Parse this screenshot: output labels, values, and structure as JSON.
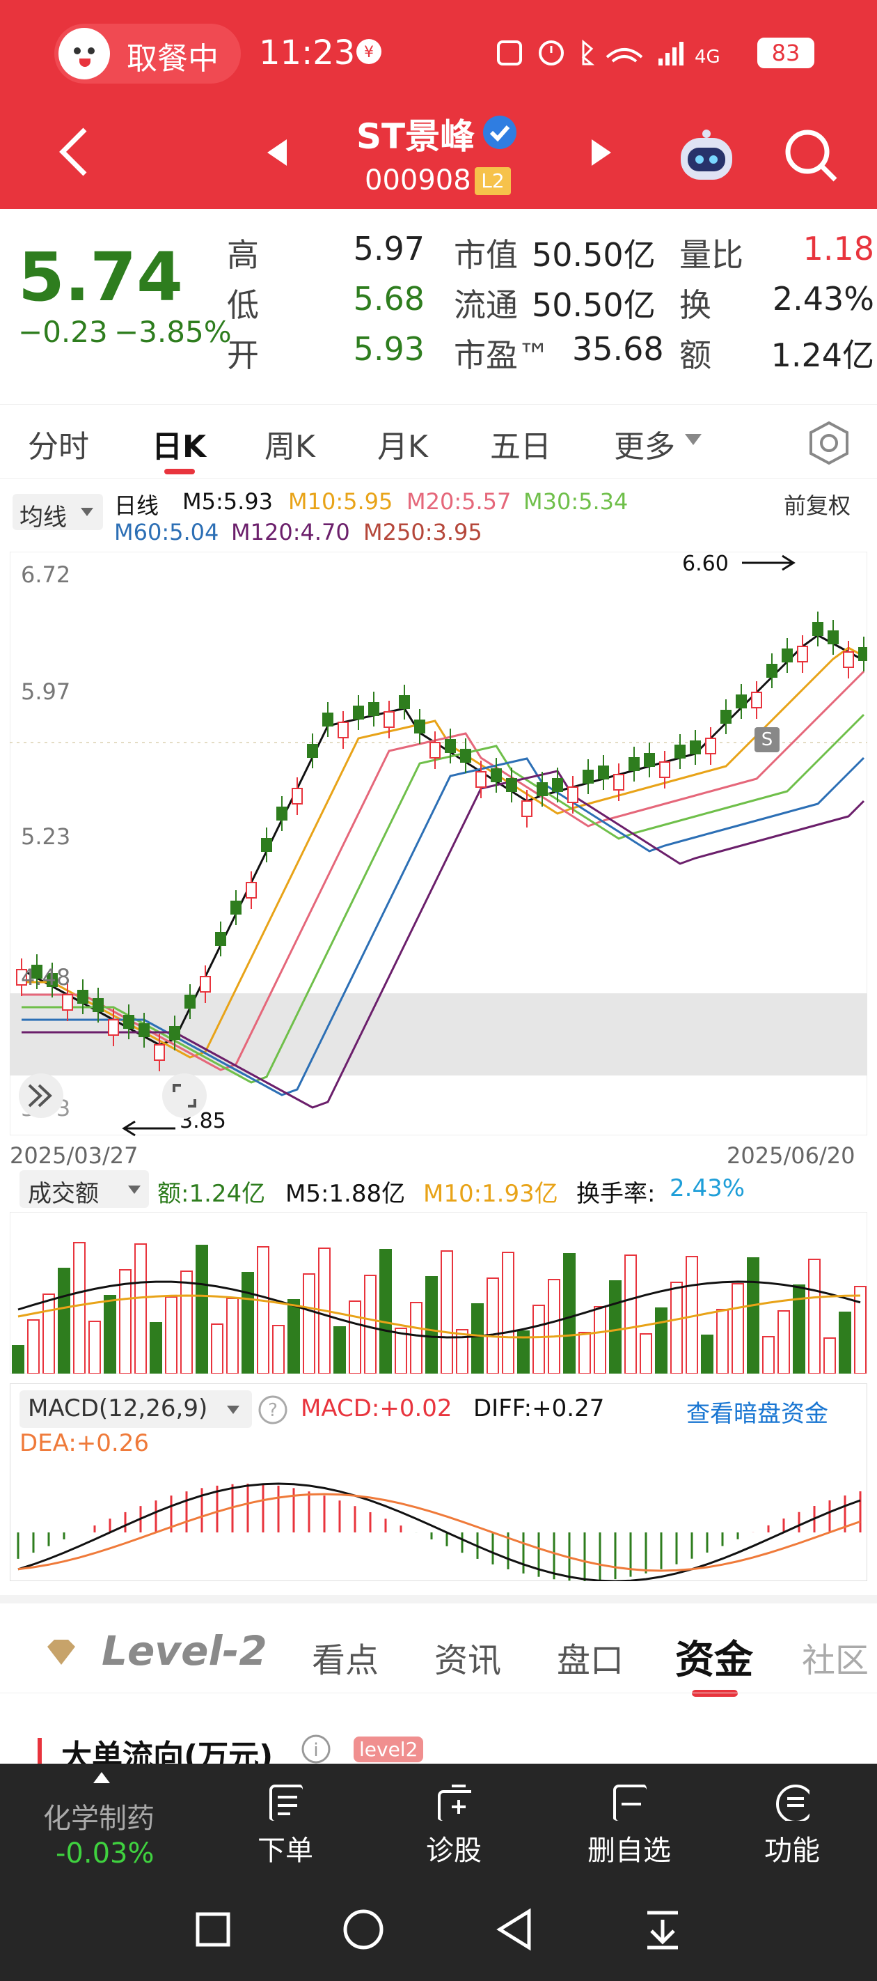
{
  "statusbar": {
    "app_pill": "取餐中",
    "time": "11:23",
    "battery": "83"
  },
  "header": {
    "stock_name": "ST景峰",
    "stock_code": "000908",
    "badge": "L2"
  },
  "quote": {
    "price": "5.74",
    "change": "−0.23",
    "change_pct": "−3.85%",
    "high_label": "高",
    "high": "5.97",
    "low_label": "低",
    "low": "5.68",
    "open_label": "开",
    "open": "5.93",
    "mcap_label": "市值",
    "mcap": "50.50亿",
    "float_label": "流通",
    "float": "50.50亿",
    "pe_label": "市盈™",
    "pe": "35.68",
    "vr_label": "量比",
    "vr": "1.18",
    "turnover_label": "换",
    "turnover": "2.43%",
    "amount_label": "额",
    "amount": "1.24亿"
  },
  "chart_tabs": [
    "分时",
    "日K",
    "周K",
    "月K",
    "五日",
    "更多"
  ],
  "ma_bar": {
    "selector": "均线",
    "period": "日线",
    "m5": "M5:5.93",
    "m10": "M10:5.95",
    "m20": "M20:5.57",
    "m30": "M30:5.34",
    "m60": "M60:5.04",
    "m120": "M120:4.70",
    "m250": "M250:3.95",
    "adjust": "前复权"
  },
  "kchart": {
    "y_labels": [
      "6.72",
      "5.97",
      "5.23",
      "4.48",
      "3.73"
    ],
    "max_label": "6.60",
    "min_label": "3.85",
    "date_start": "2025/03/27",
    "date_end": "2025/06/20",
    "s_marker": "S"
  },
  "volume": {
    "selector": "成交额",
    "amount": "额:1.24亿",
    "m5": "M5:1.88亿",
    "m10": "M10:1.93亿",
    "turnover_label": "换手率:",
    "turnover": "2.43%"
  },
  "macd": {
    "selector": "MACD(12,26,9)",
    "macd": "MACD:+0.02",
    "diff": "DIFF:+0.27",
    "link": "查看暗盘资金",
    "dea": "DEA:+0.26"
  },
  "bottom_tabs": [
    "Level-2",
    "看点",
    "资讯",
    "盘口",
    "资金",
    "社区"
  ],
  "section_title": "大单流向(万元)",
  "section_badge": "level2",
  "bottom_nav": {
    "sector": "化学制药",
    "sector_pct": "-0.03%",
    "items": [
      "下单",
      "诊股",
      "删自选",
      "功能"
    ]
  },
  "colors": {
    "brand_red": "#e8343d",
    "up_red": "#e8343d",
    "down_green": "#2e7d1e",
    "blue_link": "#1976d2"
  }
}
